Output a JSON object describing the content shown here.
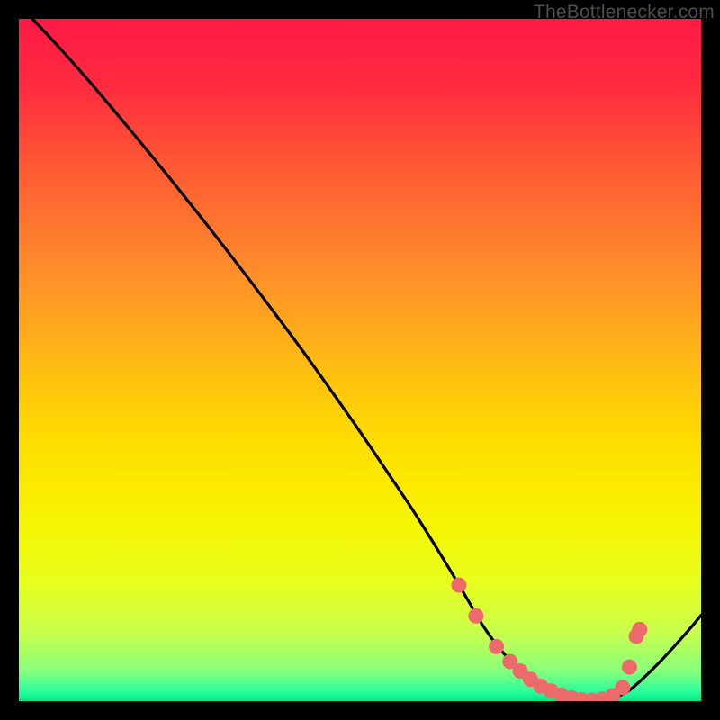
{
  "watermark": "TheBottlenecker.com",
  "gradient": {
    "stops": [
      {
        "offset": 0.0,
        "color": "#ff1a45"
      },
      {
        "offset": 0.1,
        "color": "#ff2c3f"
      },
      {
        "offset": 0.22,
        "color": "#ff5a33"
      },
      {
        "offset": 0.36,
        "color": "#ff8a2b"
      },
      {
        "offset": 0.5,
        "color": "#ffb914"
      },
      {
        "offset": 0.62,
        "color": "#ffde00"
      },
      {
        "offset": 0.74,
        "color": "#f6f500"
      },
      {
        "offset": 0.83,
        "color": "#e6ff1f"
      },
      {
        "offset": 0.9,
        "color": "#c8ff4d"
      },
      {
        "offset": 0.955,
        "color": "#89ff7a"
      },
      {
        "offset": 0.985,
        "color": "#2dff9d"
      },
      {
        "offset": 1.0,
        "color": "#00e885"
      }
    ]
  },
  "chart_data": {
    "type": "line",
    "title": "",
    "xlabel": "",
    "ylabel": "",
    "xlim": [
      0,
      100
    ],
    "ylim": [
      0,
      100
    ],
    "series": [
      {
        "name": "bottleneck-curve",
        "x": [
          2,
          6,
          10,
          14,
          18,
          22,
          26,
          30,
          34,
          38,
          42,
          46,
          50,
          54,
          58,
          62,
          64,
          66,
          68,
          70,
          72,
          74,
          76,
          78,
          80,
          82,
          84,
          86,
          88,
          90,
          94,
          98,
          100
        ],
        "y": [
          100,
          95.7,
          91.2,
          86.5,
          81.7,
          76.8,
          71.8,
          66.7,
          61.5,
          56.2,
          50.8,
          45.2,
          39.5,
          33.6,
          27.6,
          21.2,
          17.9,
          14.5,
          11.1,
          8.3,
          6.0,
          4.0,
          2.5,
          1.4,
          0.6,
          0.2,
          0.0,
          0.2,
          0.8,
          2.0,
          5.8,
          10.2,
          12.6
        ]
      }
    ],
    "markers": {
      "name": "highlight-dots",
      "color": "#ed6a6a",
      "points": [
        {
          "x": 64.5,
          "y": 17.0
        },
        {
          "x": 67.0,
          "y": 12.5
        },
        {
          "x": 70.0,
          "y": 8.0
        },
        {
          "x": 72.0,
          "y": 5.8
        },
        {
          "x": 73.5,
          "y": 4.4
        },
        {
          "x": 75.0,
          "y": 3.2
        },
        {
          "x": 76.5,
          "y": 2.2
        },
        {
          "x": 78.0,
          "y": 1.5
        },
        {
          "x": 79.5,
          "y": 0.9
        },
        {
          "x": 81.0,
          "y": 0.5
        },
        {
          "x": 82.5,
          "y": 0.2
        },
        {
          "x": 84.0,
          "y": 0.1
        },
        {
          "x": 85.5,
          "y": 0.3
        },
        {
          "x": 87.0,
          "y": 0.8
        },
        {
          "x": 88.5,
          "y": 2.0
        },
        {
          "x": 89.5,
          "y": 5.0
        },
        {
          "x": 90.5,
          "y": 9.5
        },
        {
          "x": 91.0,
          "y": 10.5
        }
      ]
    }
  }
}
